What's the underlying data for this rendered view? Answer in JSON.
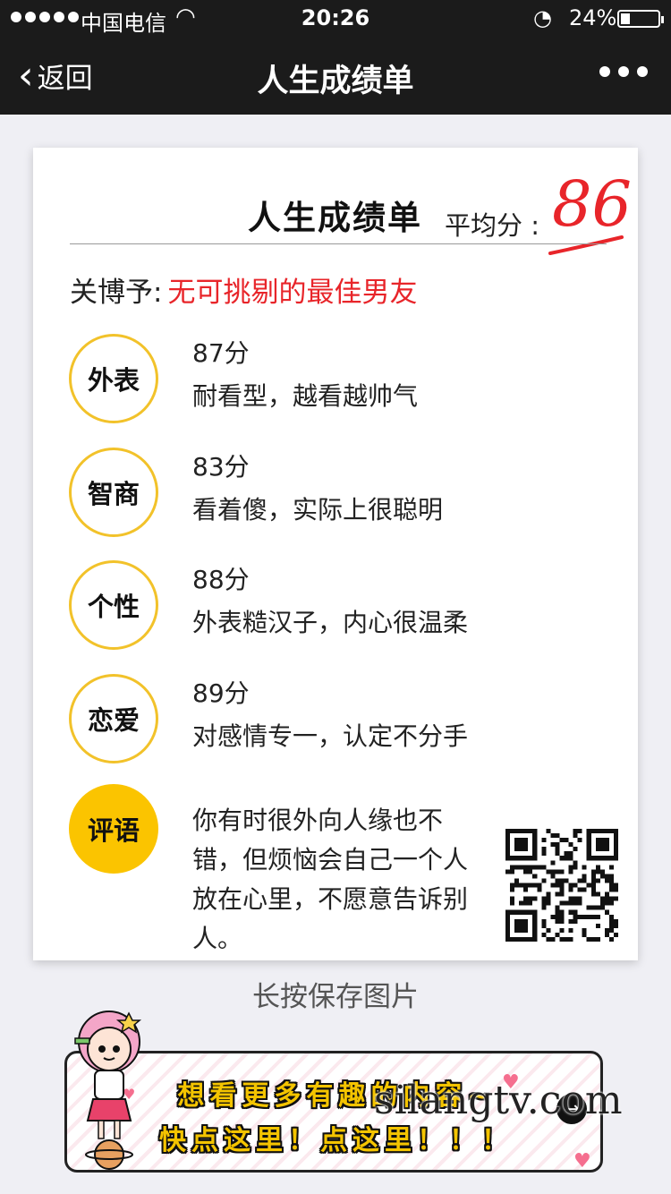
{
  "status_bar": {
    "carrier": "中国电信",
    "time": "20:26",
    "battery": "24%",
    "battery_level": 0.24,
    "signal_icon": "signal-dots-icon",
    "wifi_icon": "wifi-icon",
    "lock_icon": "rotation-lock-icon"
  },
  "nav": {
    "back_label": "返回",
    "title": "人生成绩单",
    "more_icon": "more-dots-icon"
  },
  "card": {
    "title": "人生成绩单",
    "avg_label": "平均分 :",
    "avg_score": "86",
    "person_name": "关博予:",
    "verdict": "无可挑剔的最佳男友",
    "rows": [
      {
        "label": "外表",
        "score": "87分",
        "desc": "耐看型，越看越帅气"
      },
      {
        "label": "智商",
        "score": "83分",
        "desc": "看着傻，实际上很聪明"
      },
      {
        "label": "个性",
        "score": "88分",
        "desc": "外表糙汉子，内心很温柔"
      },
      {
        "label": "恋爱",
        "score": "89分",
        "desc": "对感情专一，认定不分手"
      }
    ],
    "comment_label": "评语",
    "comment": "你有时很外向人缘也不错，但烦恼会自己一个人放在心里，不愿意告诉别人。"
  },
  "save_hint": "长按保存图片",
  "banner": {
    "line1": "想看更多有趣的内容~",
    "line2": "快点这里！点这里！！！",
    "arrow_icon": "arrow-right-icon"
  },
  "watermark": "silangtv.com",
  "colors": {
    "nav_bg": "#1b1b1b",
    "accent_red": "#e8252a",
    "accent_yellow": "#fbc400",
    "page_bg": "#efeff4"
  }
}
